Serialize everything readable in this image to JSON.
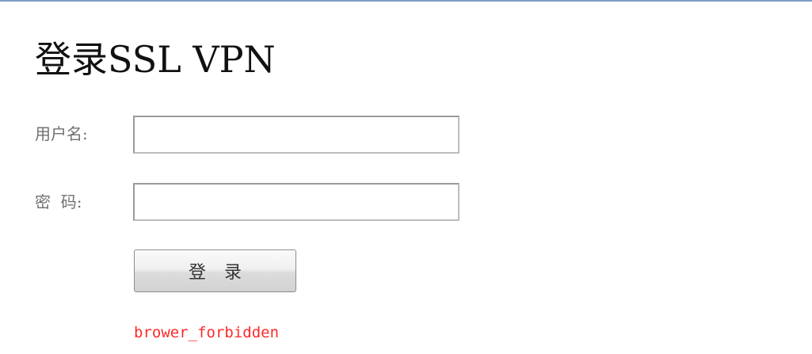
{
  "page": {
    "title": "登录SSL VPN"
  },
  "form": {
    "username_label": "用户名:",
    "username_value": "",
    "password_label": "密  码:",
    "password_value": "",
    "login_button_label": "登 录"
  },
  "message": {
    "error_text": "brower_forbidden",
    "error_color": "#ff2a2a"
  },
  "colors": {
    "top_border": "#7e9cc4",
    "label_text": "#707070"
  }
}
